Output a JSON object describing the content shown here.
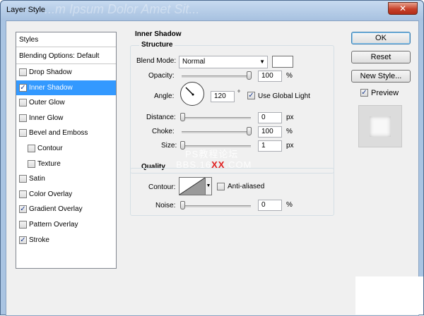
{
  "window": {
    "title": "Layer Style",
    "ghost_title": "...m Ipsum Dolor Amet Sit...",
    "close_label": "✕"
  },
  "styles_list": {
    "header": "Styles",
    "blending": "Blending Options: Default",
    "items": [
      {
        "label": "Drop Shadow",
        "checked": false,
        "selected": false,
        "indent": false
      },
      {
        "label": "Inner Shadow",
        "checked": true,
        "selected": true,
        "indent": false
      },
      {
        "label": "Outer Glow",
        "checked": false,
        "selected": false,
        "indent": false
      },
      {
        "label": "Inner Glow",
        "checked": false,
        "selected": false,
        "indent": false
      },
      {
        "label": "Bevel and Emboss",
        "checked": false,
        "selected": false,
        "indent": false
      },
      {
        "label": "Contour",
        "checked": false,
        "selected": false,
        "indent": true
      },
      {
        "label": "Texture",
        "checked": false,
        "selected": false,
        "indent": true
      },
      {
        "label": "Satin",
        "checked": false,
        "selected": false,
        "indent": false
      },
      {
        "label": "Color Overlay",
        "checked": false,
        "selected": false,
        "indent": false
      },
      {
        "label": "Gradient Overlay",
        "checked": true,
        "selected": false,
        "indent": false
      },
      {
        "label": "Pattern Overlay",
        "checked": false,
        "selected": false,
        "indent": false
      },
      {
        "label": "Stroke",
        "checked": true,
        "selected": false,
        "indent": false
      }
    ]
  },
  "inner_shadow": {
    "title": "Inner Shadow",
    "structure": {
      "title": "Structure",
      "blend_mode_label": "Blend Mode:",
      "blend_mode_value": "Normal",
      "opacity_label": "Opacity:",
      "opacity_value": "100",
      "opacity_unit": "%",
      "angle_label": "Angle:",
      "angle_value": "120",
      "angle_unit": "°",
      "use_global_light": "Use Global Light",
      "use_global_light_checked": true,
      "distance_label": "Distance:",
      "distance_value": "0",
      "distance_unit": "px",
      "choke_label": "Choke:",
      "choke_value": "100",
      "choke_unit": "%",
      "size_label": "Size:",
      "size_value": "1",
      "size_unit": "px"
    },
    "quality": {
      "title": "Quality",
      "contour_label": "Contour:",
      "anti_aliased": "Anti-aliased",
      "anti_aliased_checked": false,
      "noise_label": "Noise:",
      "noise_value": "0",
      "noise_unit": "%"
    }
  },
  "buttons": {
    "ok": "OK",
    "reset": "Reset",
    "new_style": "New Style...",
    "preview": "Preview",
    "preview_checked": true
  },
  "watermark": {
    "line1": "PS教程论坛",
    "line2_a": "BBS.16",
    "line2_red": "XX",
    "line2_b": ".COM"
  },
  "colors": {
    "accent_selected": "#3399ff",
    "window_frame": "#a9c4e2",
    "close_button": "#c7412a"
  }
}
